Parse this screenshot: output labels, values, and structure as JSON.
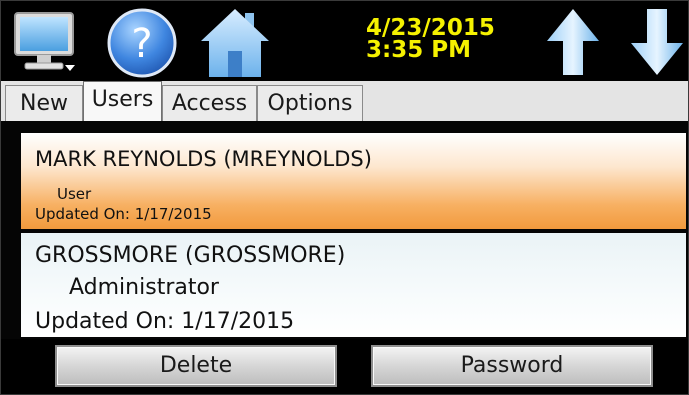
{
  "toolbar": {
    "date": "4/23/2015",
    "time": "3:35 PM",
    "clock_color": "#f5f100",
    "icons": [
      "monitor-icon",
      "help-icon",
      "home-icon",
      "up-arrow-icon",
      "down-arrow-icon"
    ],
    "help_glyph": "?"
  },
  "tabs": [
    {
      "label": "New",
      "active": false
    },
    {
      "label": "Users",
      "active": true
    },
    {
      "label": "Access",
      "active": false
    },
    {
      "label": "Options",
      "active": false
    }
  ],
  "users": [
    {
      "name": "MARK REYNOLDS (MREYNOLDS)",
      "role": "User",
      "updated": "Updated On: 1/17/2015",
      "selected": true
    },
    {
      "name": "GROSSMORE (GROSSMORE)",
      "role": "Administrator",
      "updated": "Updated On: 1/17/2015",
      "selected": false
    }
  ],
  "buttons": {
    "delete": "Delete",
    "password": "Password"
  },
  "colors": {
    "selected_row": "#f29a3d",
    "icon_blue": "#5aa8e6"
  }
}
